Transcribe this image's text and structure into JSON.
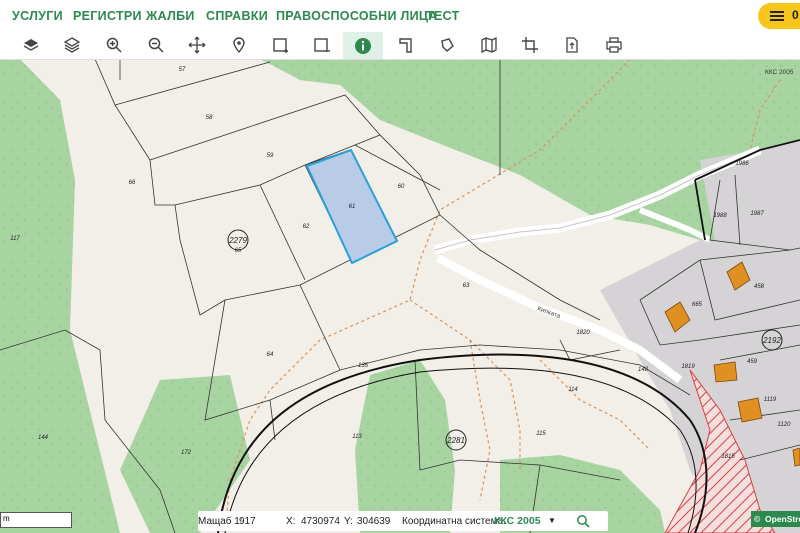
{
  "nav": {
    "items": [
      "УСЛУГИ",
      "РЕГИСТРИ",
      "ЖАЛБИ",
      "СПРАВКИ",
      "ПРАВОСПОСОБНИ ЛИЦА",
      "ТЕСТ"
    ],
    "menu_count": "0"
  },
  "toolbar": {
    "tools": [
      "layers-icon",
      "base-layers-icon",
      "zoom-in-icon",
      "zoom-out-icon",
      "pan-icon",
      "locate-icon",
      "select-rect-icon",
      "select-deselect-icon",
      "info-icon",
      "measure-line-icon",
      "measure-area-icon",
      "map-icon",
      "crop-icon",
      "export-icon",
      "print-icon"
    ],
    "active": "info-icon",
    "accent": "#2c8a4e"
  },
  "map": {
    "parcel_labels": [
      "57",
      "58",
      "59",
      "60",
      "61",
      "62",
      "63",
      "64",
      "65",
      "66",
      "117",
      "144",
      "172",
      "113",
      "115",
      "114",
      "148",
      "135",
      "665",
      "458",
      "459",
      "1119",
      "1120",
      "1988",
      "1987",
      "1986",
      "1820",
      "1815",
      "1819"
    ],
    "circled_labels": [
      "2279",
      "2281",
      "2192"
    ],
    "street": "Кипката",
    "crs_corner": "ККС 2005",
    "selected_parcel": "61",
    "colors": {
      "background": "#f2efe9",
      "forest": "#a8d4a2",
      "selection_fill": "#b8cce8",
      "selection_stroke": "#2aa0d8",
      "building": "#e09020",
      "hatch": "#d84040"
    }
  },
  "status": {
    "scale_label": "Мащаб 1:",
    "scale_value": "917",
    "x_label": "X:",
    "x_value": "4730974",
    "y_label": "Y:",
    "y_value": "304639",
    "crs_label": "Координатна система:",
    "crs_value": "ККС 2005"
  },
  "scalebar": {
    "text": "m"
  },
  "attribution": "OpenStreetMap"
}
